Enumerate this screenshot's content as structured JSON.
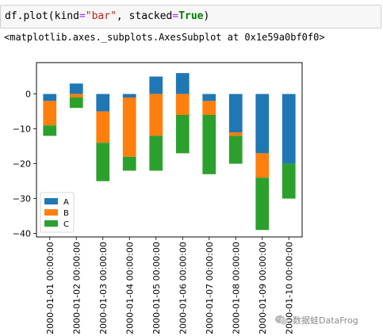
{
  "code": {
    "func": "df.plot",
    "open_paren": "(",
    "kind_kw": "kind",
    "eq1": "=",
    "kind_val": "\"bar\"",
    "comma": ", ",
    "stacked_kw": "stacked",
    "eq2": "=",
    "stacked_val": "True",
    "close_paren": ")"
  },
  "output": {
    "text": "<matplotlib.axes._subplots.AxesSubplot at 0x1e59a0bf0f0>"
  },
  "watermark": {
    "text": "数据蛙DataFrog",
    "icon": "wechat-icon"
  },
  "chart_data": {
    "type": "bar",
    "stacked": true,
    "categories": [
      "2000-01-01 00:00:00",
      "2000-01-02 00:00:00",
      "2000-01-03 00:00:00",
      "2000-01-04 00:00:00",
      "2000-01-05 00:00:00",
      "2000-01-06 00:00:00",
      "2000-01-07 00:00:00",
      "2000-01-08 00:00:00",
      "2000-01-09 00:00:00",
      "2000-01-10 00:00:00"
    ],
    "series": [
      {
        "name": "A",
        "color": "#1f77b4",
        "values": [
          -2,
          3,
          -5,
          -1,
          5,
          6,
          -2,
          -11,
          -17,
          -20
        ]
      },
      {
        "name": "B",
        "color": "#ff7f0e",
        "values": [
          -7,
          -1,
          -9,
          -17,
          -12,
          -6,
          -4,
          -1,
          -7,
          0
        ]
      },
      {
        "name": "C",
        "color": "#2ca02c",
        "values": [
          -3,
          -3,
          -11,
          -4,
          -10,
          -11,
          -17,
          -8,
          -15,
          -10
        ]
      }
    ],
    "ylim": [
      -41,
      9
    ],
    "yticks": [
      0,
      -10,
      -20,
      -30,
      -40
    ],
    "ytick_labels": [
      "0",
      "−10",
      "−20",
      "−30",
      "−40"
    ],
    "legend_position": "lower-left",
    "grid": false,
    "title": "",
    "xlabel": "",
    "ylabel": ""
  }
}
